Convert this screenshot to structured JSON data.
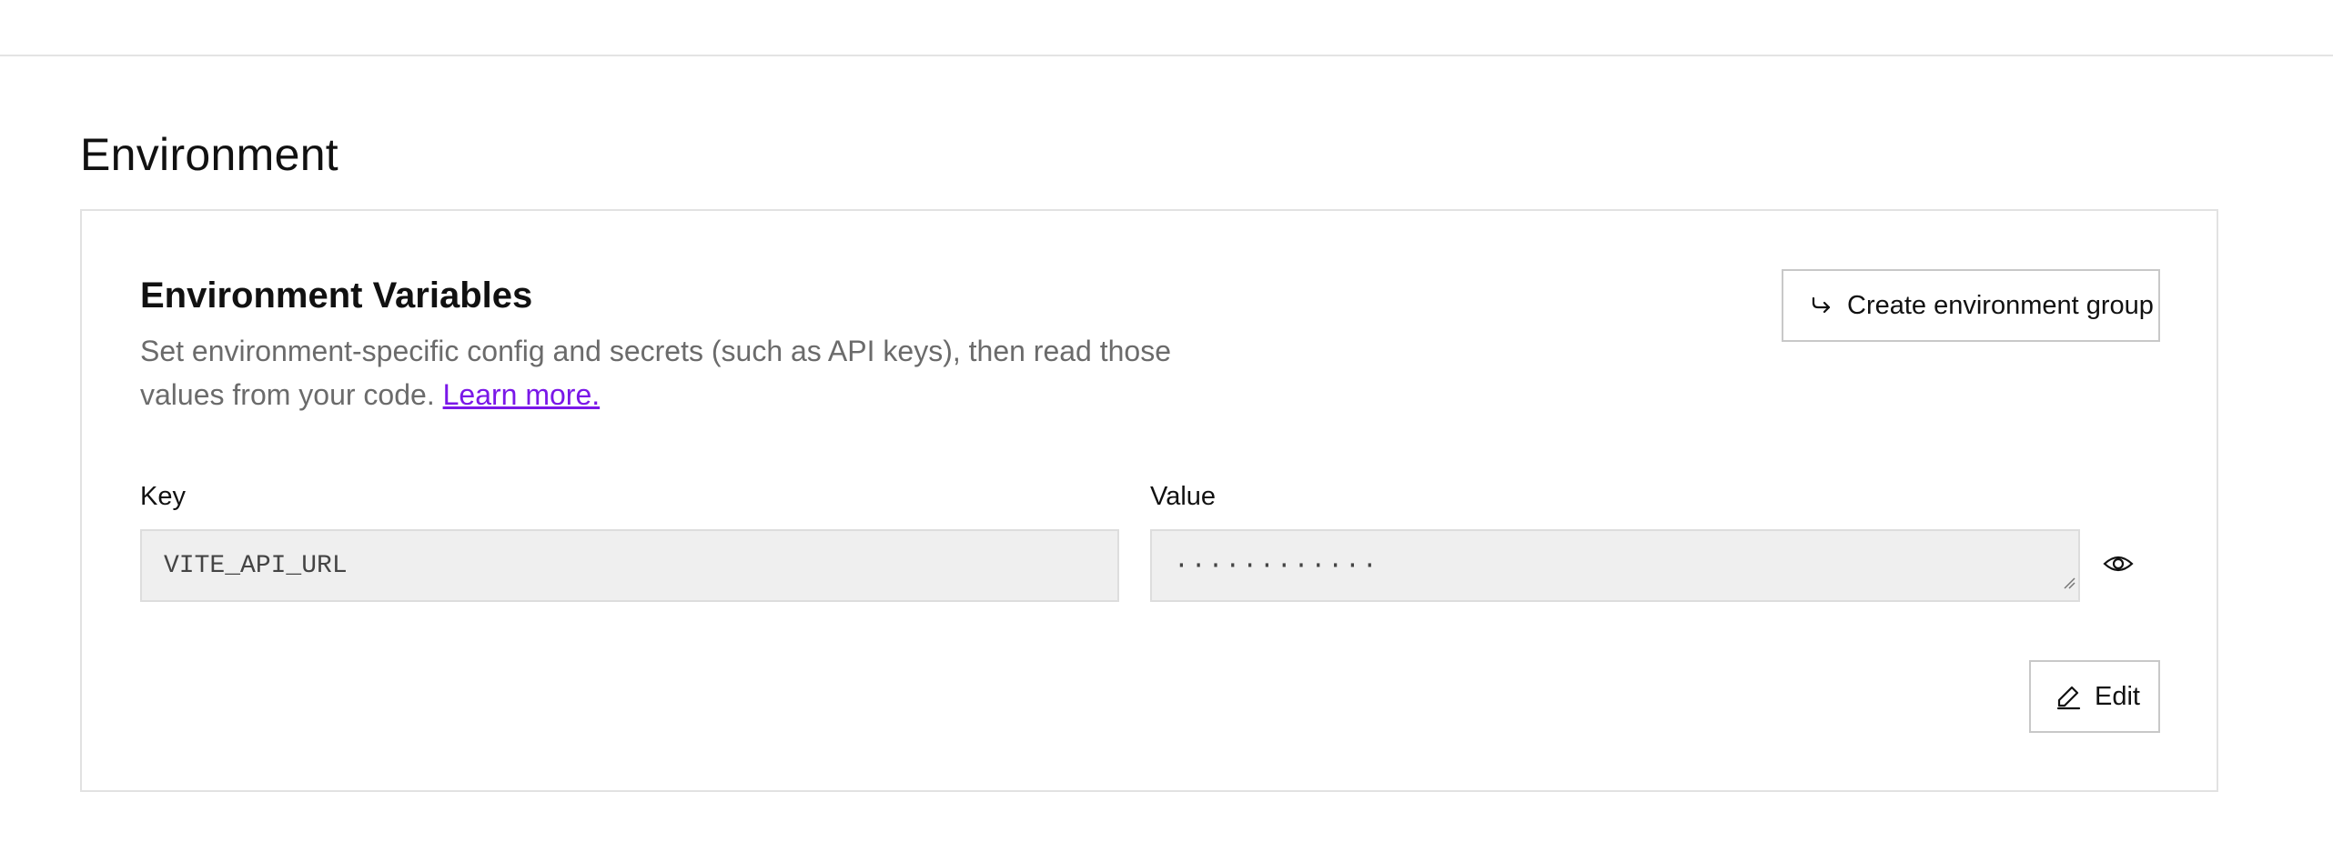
{
  "section": {
    "title": "Environment"
  },
  "card": {
    "title": "Environment Variables",
    "description": "Set environment-specific config and secrets (such as API keys), then read those values from your code.",
    "learn_more": "Learn more.",
    "create_group_label": "Create environment group",
    "create_group_icon": "redirect-arrow-icon",
    "key_label": "Key",
    "value_label": "Value",
    "key_value": "VITE_API_URL",
    "value_masked": "············",
    "reveal_icon": "eye-icon",
    "edit_label": "Edit",
    "edit_icon": "pencil-icon"
  },
  "colors": {
    "link": "#7a17e8",
    "field_bg": "#efefef",
    "border": "#e2e2e2",
    "muted_text": "#6b6b6b"
  }
}
